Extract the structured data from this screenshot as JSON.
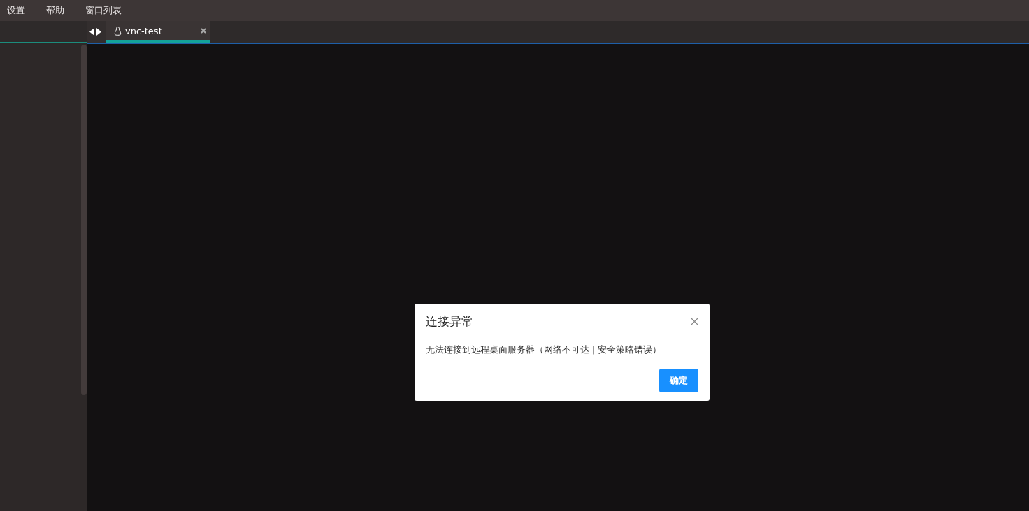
{
  "menu": [
    {
      "label": "设置"
    },
    {
      "label": "帮助"
    },
    {
      "label": "窗口列表"
    }
  ],
  "tabs": [
    {
      "label": "vnc-test",
      "selected": true
    }
  ],
  "dialog": {
    "title": "连接异常",
    "message": "无法连接到远程桌面服务器（网络不可达 | 安全策略错误）",
    "button": "确定"
  }
}
